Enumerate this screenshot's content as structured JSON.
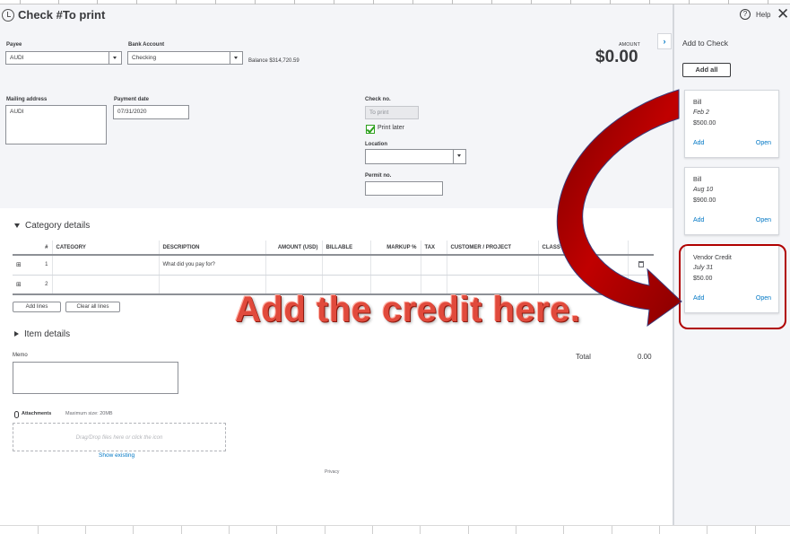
{
  "app": {
    "title": "Check #To print",
    "help_label": "Help"
  },
  "form": {
    "payee_label": "Payee",
    "payee_value": "AUDI",
    "bank_account_label": "Bank Account",
    "bank_account_value": "Checking",
    "balance_text": "Balance $314,720.59",
    "amount_label": "AMOUNT",
    "amount_value": "$0.00",
    "mailing_address_label": "Mailing address",
    "mailing_address_value": "AUDI",
    "payment_date_label": "Payment date",
    "payment_date_value": "07/31/2020",
    "check_no_label": "Check no.",
    "check_no_value": "To print",
    "print_later_label": "Print later",
    "print_later_checked": true,
    "location_label": "Location",
    "location_value": "",
    "permit_no_label": "Permit no.",
    "permit_no_value": ""
  },
  "category_details": {
    "title": "Category details",
    "columns": [
      "#",
      "CATEGORY",
      "DESCRIPTION",
      "AMOUNT (USD)",
      "BILLABLE",
      "MARKUP %",
      "TAX",
      "CUSTOMER / PROJECT",
      "CLASS"
    ],
    "rows": [
      {
        "num": "1",
        "category": "",
        "description_placeholder": "What did you pay for?"
      },
      {
        "num": "2",
        "category": "",
        "description_placeholder": ""
      }
    ],
    "add_lines_label": "Add lines",
    "clear_all_lines_label": "Clear all lines"
  },
  "item_details": {
    "title": "Item details"
  },
  "memo": {
    "label": "Memo",
    "value": ""
  },
  "totals": {
    "label": "Total",
    "value": "0.00"
  },
  "attachments": {
    "label": "Attachments",
    "max_size": "Maximum size: 20MB",
    "drop_text": "Drag/Drop files here or click the icon",
    "show_existing": "Show existing"
  },
  "footer": {
    "privacy": "Privacy"
  },
  "drawer": {
    "title": "Add to Check",
    "add_all_label": "Add all",
    "cards": [
      {
        "type": "Bill",
        "date": "Feb 2",
        "amount": "$500.00",
        "add": "Add",
        "open": "Open"
      },
      {
        "type": "Bill",
        "date": "Aug 10",
        "amount": "$900.00",
        "add": "Add",
        "open": "Open"
      },
      {
        "type": "Vendor Credit",
        "date": "July 31",
        "amount": "$50.00",
        "add": "Add",
        "open": "Open"
      }
    ]
  },
  "annotation": {
    "callout_text": "Add the credit here.",
    "arrow_color": "#a80000",
    "highlight_color": "#b00000"
  },
  "colors": {
    "link": "#0077c5",
    "text": "#393a3d",
    "header_bg": "#f4f5f8",
    "check_green": "#2ca01c"
  }
}
